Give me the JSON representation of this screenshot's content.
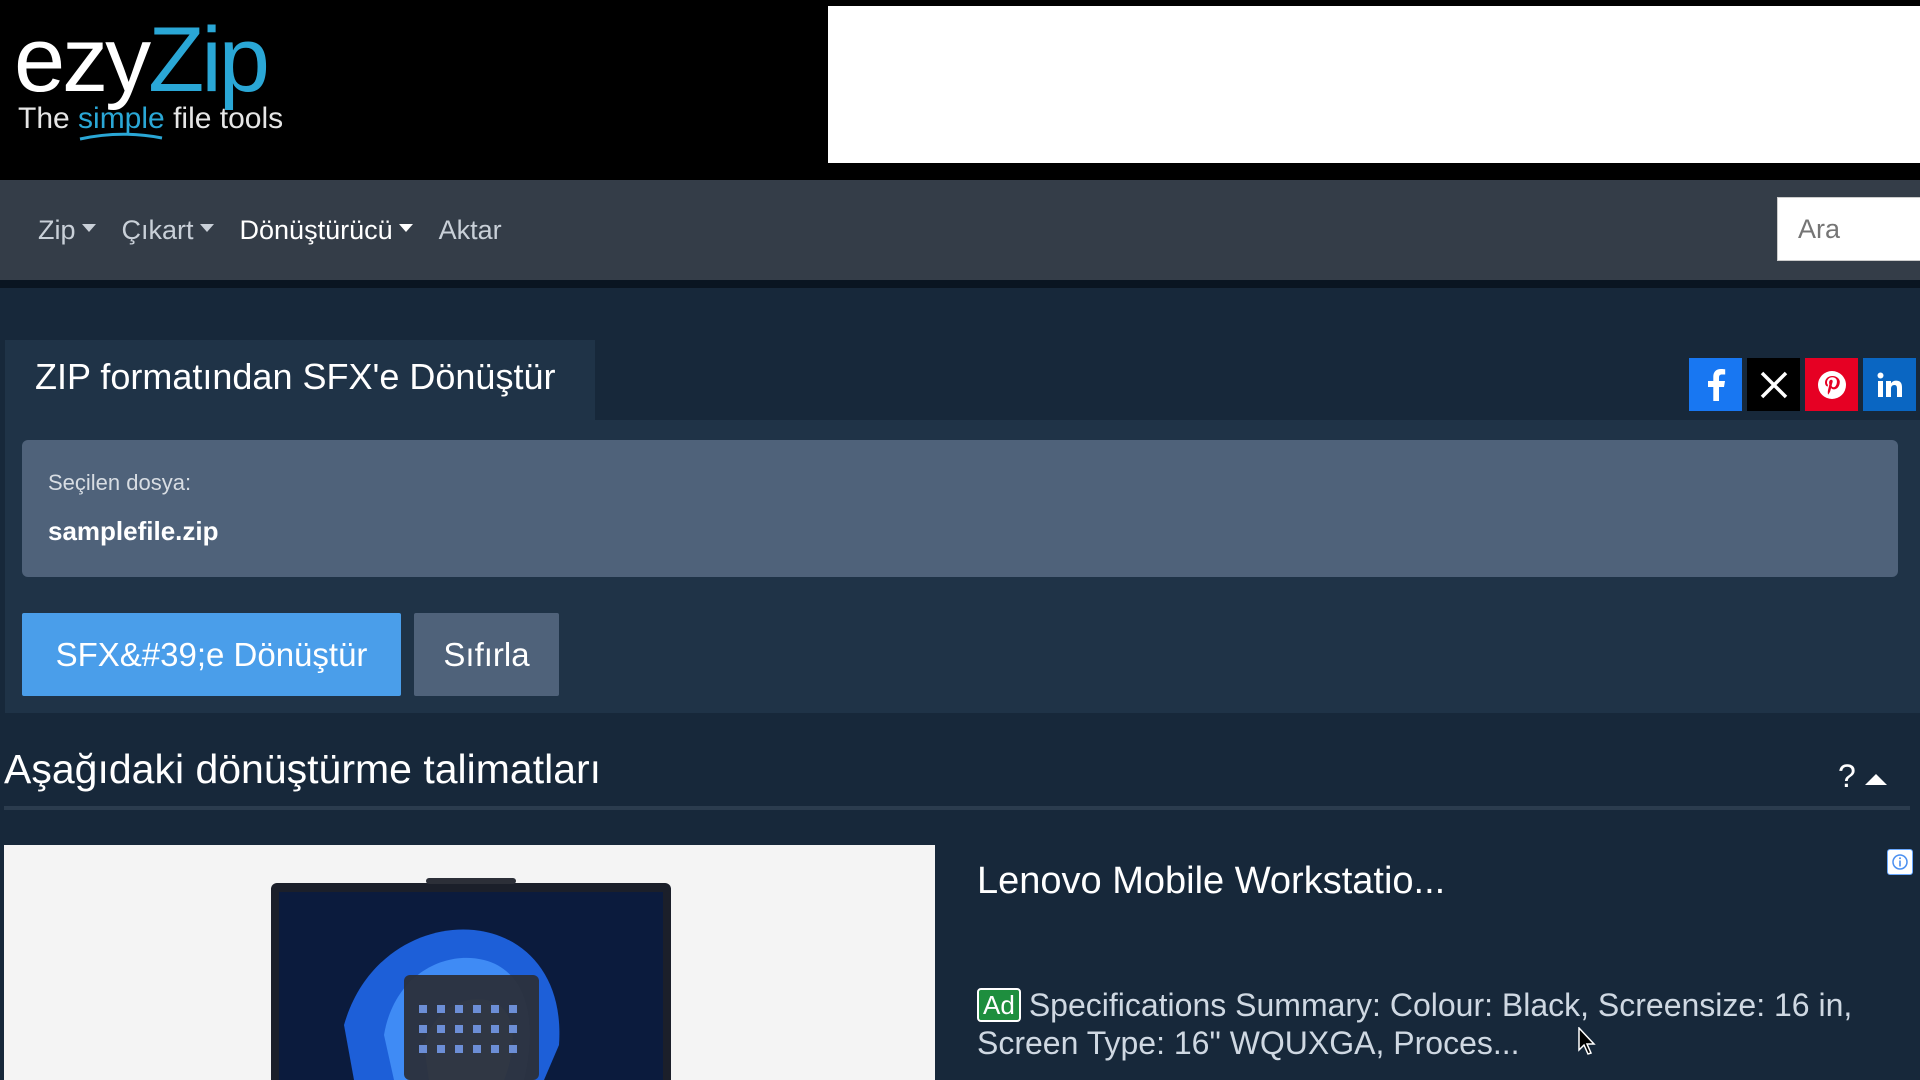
{
  "logo": {
    "brand_part1": "ezy",
    "brand_part2": "Zip",
    "tagline_pre": "The ",
    "tagline_highlight": "simple",
    "tagline_post": " file tools"
  },
  "nav": {
    "items": [
      {
        "label": "Zip",
        "has_dropdown": true
      },
      {
        "label": "Çıkart",
        "has_dropdown": true
      },
      {
        "label": "Dönüştürücü",
        "has_dropdown": true
      },
      {
        "label": "Aktar",
        "has_dropdown": false
      }
    ],
    "search_placeholder": "Ara"
  },
  "tool": {
    "title": "ZIP formatından SFX'e Dönüştür",
    "selected_file_label": "Seçilen dosya:",
    "selected_file_name": "samplefile.zip",
    "convert_button": "SFX&#39;e Dönüştür",
    "reset_button": "Sıfırla"
  },
  "social": {
    "facebook": "f",
    "x": "X",
    "pinterest": "P",
    "linkedin": "in"
  },
  "instructions": {
    "title": "Aşağıdaki dönüştürme talimatları",
    "help": "?"
  },
  "ad": {
    "title": "Lenovo Mobile Workstatio...",
    "badge": "Ad",
    "description": "Specifications Summary: Colour: Black, Screensize: 16 in, Screen Type: 16\" WQUXGA, Proces..."
  },
  "colors": {
    "brand_blue": "#2aa7d6",
    "page_bg": "#17283a",
    "navbar_bg": "#343d48",
    "panel_bg": "#1f3347",
    "primary_button": "#4a9eea",
    "ad_badge": "#1e8e3e"
  }
}
